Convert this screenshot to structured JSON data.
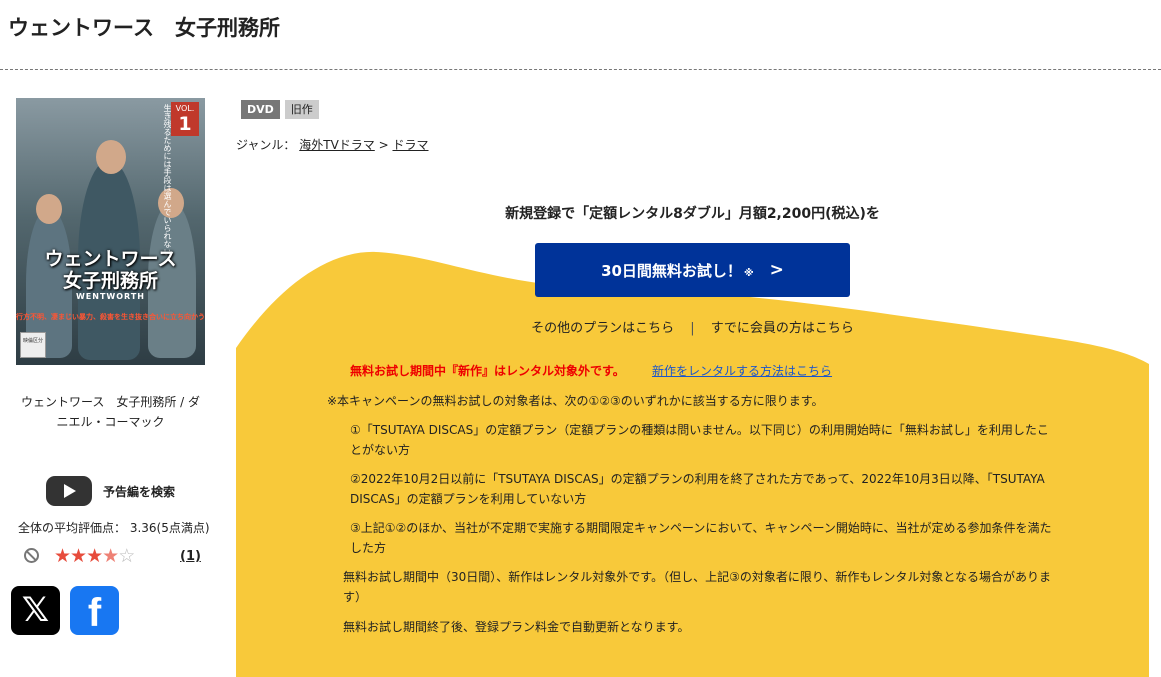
{
  "page": {
    "title": "ウェントワース　女子刑務所"
  },
  "cover": {
    "vol_label": "VOL.",
    "vol_number": "1",
    "tagline": "生き残るためには手段は選んでいられない",
    "title_line1": "ウェントワース",
    "title_line2": "女子刑務所",
    "subtitle": "WENTWORTH",
    "band": "行方不明、凄まじい暴力、殺害を生き抜き合いに立ち向かう!!",
    "rating_mark": "映倫区分"
  },
  "work": {
    "name": "ウェントワース　女子刑務所 / ダニエル・コーマック"
  },
  "trailer": {
    "label": "予告編を検索"
  },
  "rating": {
    "summary": "全体の平均評価点： 3.36(5点満点)",
    "average": 3.36,
    "max": 5,
    "review_count": "(1)"
  },
  "badges": {
    "format": "DVD",
    "status": "旧作"
  },
  "genre": {
    "label": "ジャンル：",
    "primary": "海外TVドラマ",
    "separator": " > ",
    "secondary": "ドラマ"
  },
  "promo": {
    "headline": "新規登録で「定額レンタル8ダブル」月額2,200円(税込)を",
    "cta_label": "30日間無料お試し！",
    "cta_note": "※",
    "other_plans": "その他のプランはこちら",
    "link_separator": "|",
    "members": "すでに会員の方はこちら",
    "notice": "無料お試し期間中『新作』はレンタル対象外です。",
    "notice_link": "新作をレンタルする方法はこちら",
    "intro": "※本キャンペーンの無料お試しの対象者は、次の①②③のいずれかに該当する方に限ります。",
    "condition1": "①「TSUTAYA DISCAS」の定額プラン（定額プランの種類は問いません。以下同じ）の利用開始時に「無料お試し」を利用したことがない方",
    "condition2": "②2022年10月2日以前に「TSUTAYA DISCAS」の定額プランの利用を終了された方であって、2022年10月3日以降、「TSUTAYA DISCAS」の定額プランを利用していない方",
    "condition3": "③上記①②のほか、当社が不定期で実施する期間限定キャンペーンにおいて、キャンペーン開始時に、当社が定める参加条件を満たした方",
    "period_note": "無料お試し期間中（30日間）、新作はレンタル対象外です。（但し、上記③の対象者に限り、新作もレンタル対象となる場合があります）",
    "renewal_note": "無料お試し期間終了後、登録プラン料金で自動更新となります。"
  },
  "colors": {
    "cta": "#003399",
    "promo_background": "#f8c93a",
    "notice": "#e00000",
    "link": "#1a55cc",
    "star": "#e74c3c"
  }
}
